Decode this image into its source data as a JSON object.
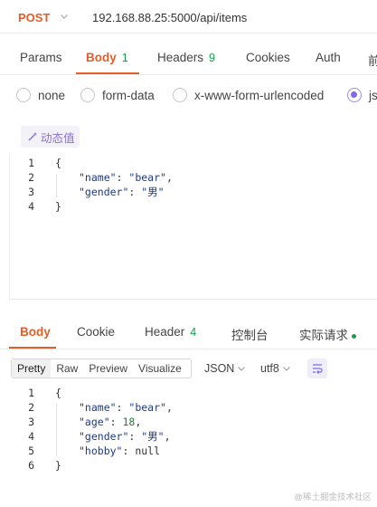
{
  "request": {
    "method": "POST",
    "url": "192.168.88.25:5000/api/items"
  },
  "tabs": [
    {
      "label": "Params"
    },
    {
      "label": "Body",
      "count": "1"
    },
    {
      "label": "Headers",
      "count": "9"
    },
    {
      "label": "Cookies"
    },
    {
      "label": "Auth"
    },
    {
      "label": "前"
    }
  ],
  "body_types": [
    {
      "label": "none",
      "selected": false
    },
    {
      "label": "form-data",
      "selected": false
    },
    {
      "label": "x-www-form-urlencoded",
      "selected": false
    },
    {
      "label": "js",
      "selected": true
    }
  ],
  "dynamic_value_label": "动态值",
  "request_body": {
    "line_numbers": [
      "1",
      "2",
      "3",
      "4"
    ],
    "lines": [
      {
        "text": "{"
      },
      {
        "key": "\"name\"",
        "value": "\"bear\"",
        "trail": ","
      },
      {
        "key": "\"gender\"",
        "value": "\"男\"",
        "trail": ""
      },
      {
        "text": "}"
      }
    ]
  },
  "response_tabs": [
    {
      "label": "Body"
    },
    {
      "label": "Cookie"
    },
    {
      "label": "Header",
      "count": "4"
    },
    {
      "label": "控制台"
    },
    {
      "label": "实际请求"
    }
  ],
  "response_toolbar": {
    "formats": [
      "Pretty",
      "Raw",
      "Preview",
      "Visualize"
    ],
    "active_format": "Pretty",
    "language": "JSON",
    "encoding": "utf8"
  },
  "response_body": {
    "line_numbers": [
      "1",
      "2",
      "3",
      "4",
      "5",
      "6"
    ],
    "lines": [
      {
        "text": "{"
      },
      {
        "key": "\"name\"",
        "value": "\"bear\"",
        "trail": ","
      },
      {
        "key": "\"age\"",
        "value": "18",
        "trail": ","
      },
      {
        "key": "\"gender\"",
        "value": "\"男\"",
        "trail": ","
      },
      {
        "key": "\"hobby\"",
        "value": "null",
        "trail": ""
      },
      {
        "text": "}"
      }
    ]
  },
  "watermark": "@稀土掘金技术社区",
  "colors": {
    "accent": "#e35e28",
    "count_green": "#12a14a",
    "purple": "#8468e6"
  },
  "icons": [
    "chevron-down-icon",
    "magic-wand-icon",
    "wrap-lines-icon",
    "status-dot-icon"
  ]
}
